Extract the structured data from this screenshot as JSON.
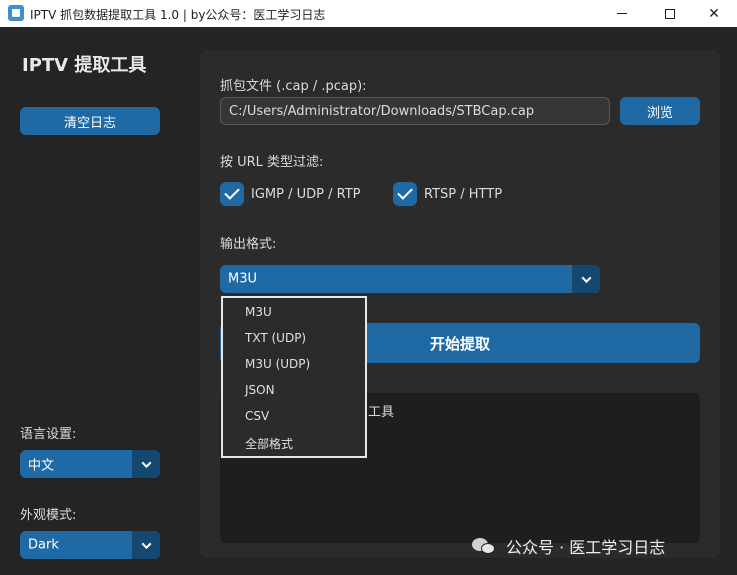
{
  "window": {
    "title": "IPTV 抓包数据提取工具 1.0 | by公众号：医工学习日志"
  },
  "sidebar": {
    "title": "IPTV 提取工具",
    "clear_log_label": "清空日志",
    "language_label": "语言设置:",
    "language_value": "中文",
    "appearance_label": "外观模式:",
    "appearance_value": "Dark"
  },
  "main": {
    "file_label": "抓包文件 (.cap / .pcap):",
    "file_path": "C:/Users/Administrator/Downloads/STBCap.cap",
    "browse_label": "浏览",
    "filter_label": "按 URL 类型过滤:",
    "filters": [
      {
        "label": "IGMP / UDP / RTP",
        "checked": true
      },
      {
        "label": "RTSP / HTTP",
        "checked": true
      }
    ],
    "format_label": "输出格式:",
    "format_value": "M3U",
    "extract_label": "开始提取",
    "log_text": "工具"
  },
  "format_dropdown": {
    "options": [
      "M3U",
      "TXT (UDP)",
      "M3U (UDP)",
      "JSON",
      "CSV",
      "全部格式"
    ]
  },
  "watermark": {
    "text": "公众号 · 医工学习日志"
  },
  "colors": {
    "accent": "#1f6aa5",
    "accent_dark": "#144870",
    "background": "#242424",
    "panel": "#2b2b2b"
  }
}
